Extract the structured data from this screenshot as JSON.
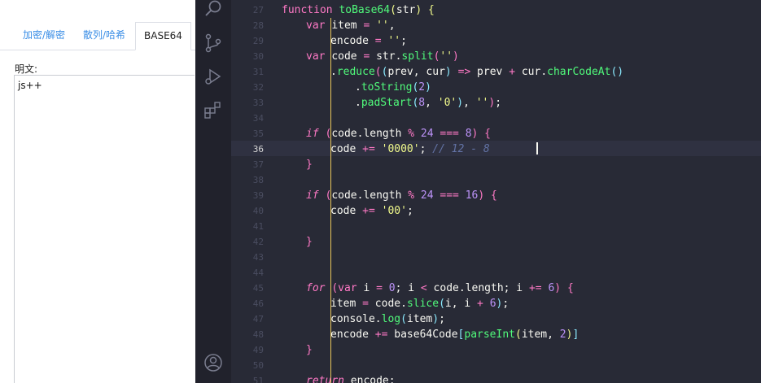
{
  "left_panel": {
    "tabs": [
      {
        "label": "加密/解密",
        "active": false
      },
      {
        "label": "散列/哈希",
        "active": false
      },
      {
        "label": "BASE64",
        "active": true
      }
    ],
    "plaintext_label": "明文:",
    "plaintext_value": "js++"
  },
  "activity_bar": {
    "icons": [
      "search-icon",
      "source-control-icon",
      "run-debug-icon",
      "extensions-icon",
      "account-icon"
    ]
  },
  "editor": {
    "current_line": 36,
    "lines": [
      {
        "n": "27",
        "tokens": [
          [
            "kw",
            "function "
          ],
          [
            "fn",
            "toBase64"
          ],
          [
            "br1",
            "("
          ],
          [
            "pl",
            "str"
          ],
          [
            "br1",
            ")"
          ],
          [
            "pl",
            " "
          ],
          [
            "br1",
            "{"
          ]
        ]
      },
      {
        "n": "28",
        "tokens": [
          [
            "kw",
            "var "
          ],
          [
            "pl",
            "item "
          ],
          [
            "op",
            "="
          ],
          [
            "pl",
            " "
          ],
          [
            "str",
            "''"
          ],
          [
            "pl",
            ","
          ]
        ]
      },
      {
        "n": "29",
        "tokens": [
          [
            "pl",
            "encode "
          ],
          [
            "op",
            "="
          ],
          [
            "pl",
            " "
          ],
          [
            "str",
            "''"
          ],
          [
            "pl",
            ";"
          ]
        ]
      },
      {
        "n": "30",
        "tokens": [
          [
            "kw",
            "var "
          ],
          [
            "pl",
            "code "
          ],
          [
            "op",
            "="
          ],
          [
            "pl",
            " str."
          ],
          [
            "fn",
            "split"
          ],
          [
            "br2",
            "("
          ],
          [
            "str",
            "''"
          ],
          [
            "br2",
            ")"
          ]
        ]
      },
      {
        "n": "31",
        "tokens": [
          [
            "pl",
            "."
          ],
          [
            "fn",
            "reduce"
          ],
          [
            "br2",
            "("
          ],
          [
            "br3",
            "("
          ],
          [
            "pl",
            "prev, cur"
          ],
          [
            "br3",
            ")"
          ],
          [
            "pl",
            " "
          ],
          [
            "op",
            "=>"
          ],
          [
            "pl",
            " prev "
          ],
          [
            "op",
            "+"
          ],
          [
            "pl",
            " cur."
          ],
          [
            "fn",
            "charCodeAt"
          ],
          [
            "br3",
            "("
          ],
          [
            "br3",
            ")"
          ]
        ]
      },
      {
        "n": "32",
        "tokens": [
          [
            "pl",
            "."
          ],
          [
            "fn",
            "toString"
          ],
          [
            "br3",
            "("
          ],
          [
            "num",
            "2"
          ],
          [
            "br3",
            ")"
          ]
        ]
      },
      {
        "n": "33",
        "tokens": [
          [
            "pl",
            "."
          ],
          [
            "fn",
            "padStart"
          ],
          [
            "br3",
            "("
          ],
          [
            "num",
            "8"
          ],
          [
            "pl",
            ", "
          ],
          [
            "str",
            "'0'"
          ],
          [
            "br3",
            ")"
          ],
          [
            "pl",
            ", "
          ],
          [
            "str",
            "''"
          ],
          [
            "br2",
            ")"
          ],
          [
            "pl",
            ";"
          ]
        ]
      },
      {
        "n": "34",
        "tokens": []
      },
      {
        "n": "35",
        "tokens": [
          [
            "kwi",
            "if "
          ],
          [
            "br2",
            "("
          ],
          [
            "pl",
            "code.length "
          ],
          [
            "op",
            "%"
          ],
          [
            "pl",
            " "
          ],
          [
            "num",
            "24"
          ],
          [
            "pl",
            " "
          ],
          [
            "op",
            "==="
          ],
          [
            "pl",
            " "
          ],
          [
            "num",
            "8"
          ],
          [
            "br2",
            ")"
          ],
          [
            "pl",
            " "
          ],
          [
            "br2",
            "{"
          ]
        ]
      },
      {
        "n": "36",
        "tokens": [
          [
            "pl",
            "code "
          ],
          [
            "op",
            "+="
          ],
          [
            "pl",
            " "
          ],
          [
            "str",
            "'0000'"
          ],
          [
            "pl",
            "; "
          ],
          [
            "cm",
            "// 12 - 8"
          ]
        ]
      },
      {
        "n": "37",
        "tokens": [
          [
            "br2",
            "}"
          ]
        ]
      },
      {
        "n": "38",
        "tokens": []
      },
      {
        "n": "39",
        "tokens": [
          [
            "kwi",
            "if "
          ],
          [
            "br2",
            "("
          ],
          [
            "pl",
            "code.length "
          ],
          [
            "op",
            "%"
          ],
          [
            "pl",
            " "
          ],
          [
            "num",
            "24"
          ],
          [
            "pl",
            " "
          ],
          [
            "op",
            "==="
          ],
          [
            "pl",
            " "
          ],
          [
            "num",
            "16"
          ],
          [
            "br2",
            ")"
          ],
          [
            "pl",
            " "
          ],
          [
            "br2",
            "{"
          ]
        ]
      },
      {
        "n": "40",
        "tokens": [
          [
            "pl",
            "code "
          ],
          [
            "op",
            "+="
          ],
          [
            "pl",
            " "
          ],
          [
            "str",
            "'00'"
          ],
          [
            "pl",
            ";"
          ]
        ]
      },
      {
        "n": "41",
        "tokens": []
      },
      {
        "n": "42",
        "tokens": [
          [
            "br2",
            "}"
          ]
        ]
      },
      {
        "n": "43",
        "tokens": []
      },
      {
        "n": "44",
        "tokens": []
      },
      {
        "n": "45",
        "tokens": [
          [
            "kwi",
            "for "
          ],
          [
            "br2",
            "("
          ],
          [
            "kw",
            "var "
          ],
          [
            "pl",
            "i "
          ],
          [
            "op",
            "="
          ],
          [
            "pl",
            " "
          ],
          [
            "num",
            "0"
          ],
          [
            "pl",
            "; i "
          ],
          [
            "op",
            "<"
          ],
          [
            "pl",
            " code.length; i "
          ],
          [
            "op",
            "+="
          ],
          [
            "pl",
            " "
          ],
          [
            "num",
            "6"
          ],
          [
            "br2",
            ")"
          ],
          [
            "pl",
            " "
          ],
          [
            "br2",
            "{"
          ]
        ]
      },
      {
        "n": "46",
        "tokens": [
          [
            "pl",
            "item "
          ],
          [
            "op",
            "="
          ],
          [
            "pl",
            " code."
          ],
          [
            "fn",
            "slice"
          ],
          [
            "br3",
            "("
          ],
          [
            "pl",
            "i, i "
          ],
          [
            "op",
            "+"
          ],
          [
            "pl",
            " "
          ],
          [
            "num",
            "6"
          ],
          [
            "br3",
            ")"
          ],
          [
            "pl",
            ";"
          ]
        ]
      },
      {
        "n": "47",
        "tokens": [
          [
            "pl",
            "console."
          ],
          [
            "fn",
            "log"
          ],
          [
            "br3",
            "("
          ],
          [
            "pl",
            "item"
          ],
          [
            "br3",
            ")"
          ],
          [
            "pl",
            ";"
          ]
        ]
      },
      {
        "n": "48",
        "tokens": [
          [
            "pl",
            "encode "
          ],
          [
            "op",
            "+="
          ],
          [
            "pl",
            " base64Code"
          ],
          [
            "br3",
            "["
          ],
          [
            "fn",
            "parseInt"
          ],
          [
            "br1",
            "("
          ],
          [
            "pl",
            "item, "
          ],
          [
            "num",
            "2"
          ],
          [
            "br1",
            ")"
          ],
          [
            "br3",
            "]"
          ]
        ]
      },
      {
        "n": "49",
        "tokens": [
          [
            "br2",
            "}"
          ]
        ]
      },
      {
        "n": "50",
        "tokens": []
      },
      {
        "n": "51",
        "tokens": [
          [
            "kwi",
            "return "
          ],
          [
            "pl",
            "encode;"
          ]
        ]
      }
    ]
  }
}
